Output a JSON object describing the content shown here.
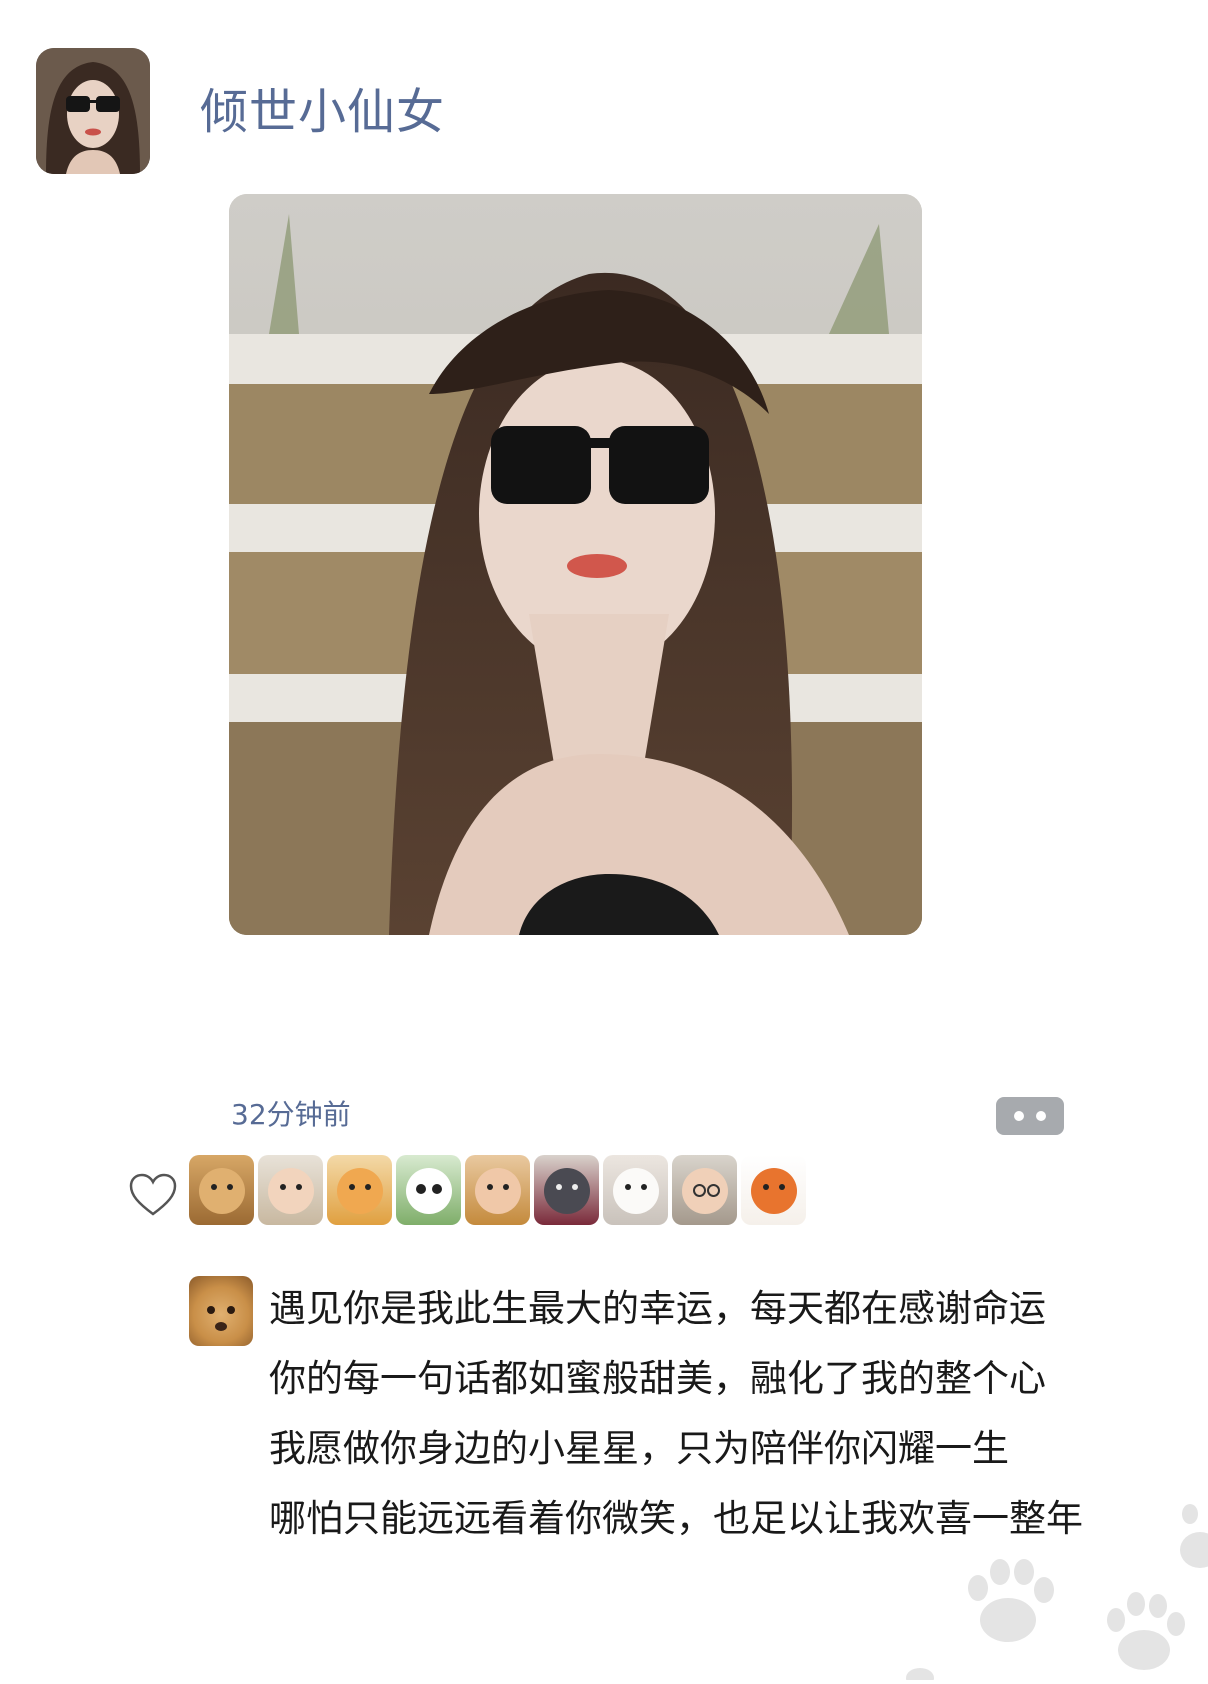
{
  "post": {
    "author_name": "倾世小仙女",
    "time": "32分钟前",
    "likes": {
      "avatars": [
        "golden-retriever-puppy",
        "baby-with-bear",
        "orange-kitten",
        "panda",
        "girl-with-sunflower",
        "french-bulldog",
        "white-kitten",
        "baby-with-glasses",
        "shiba-inu"
      ]
    },
    "comment": {
      "lines": [
        "遇见你是我此生最大的幸运，每天都在感谢命运",
        "你的每一句话都如蜜般甜美，融化了我的整个心",
        "我愿做你身边的小星星，只为陪伴你闪耀一生",
        "哪怕只能远远看着你微笑，也足以让我欢喜一整年"
      ]
    }
  },
  "colors": {
    "name_link": "#576b95",
    "text": "#191919",
    "more_button": "#a7aaae"
  }
}
